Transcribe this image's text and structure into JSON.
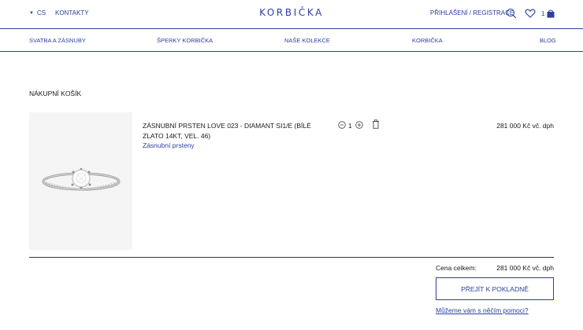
{
  "header": {
    "language": "CS",
    "contacts": "KONTAKTY",
    "logo": "KORBIČKA",
    "login": "PŘIHLÁŠENÍ / REGISTRACE",
    "cart_count": "1"
  },
  "nav": {
    "items": [
      "SVATBA A ZÁSNUBY",
      "ŠPERKY KORBIČKA",
      "NAŠE KOLEKCE",
      "KORBIČKA",
      "BLOG"
    ]
  },
  "cart": {
    "title": "NÁKUPNÍ KOŠÍK",
    "items": [
      {
        "name": "ZÁSNUBNÍ PRSTEN LOVE 023 - DIAMANT SI1/E (BÍLÉ ZLATO 14KT, VEL. 46)",
        "category": "Zásnubní prsteny",
        "quantity": "1",
        "price": "281 000 Kč vč. dph"
      }
    ],
    "total_label": "Cena celkem:",
    "total_value": "281 000 Kč vč. dph",
    "checkout_label": "PŘEJÍT K POKLADNĚ",
    "help_link": "Můžeme vám s něčím pomoci?"
  },
  "colors": {
    "accent": "#2d3fa0",
    "text": "#1a1a1a",
    "image_bg": "#f5f5f5"
  },
  "icons": [
    "triangle-down-icon",
    "search-icon",
    "heart-icon",
    "cart-icon",
    "minus-circle-icon",
    "plus-circle-icon",
    "trash-icon"
  ]
}
